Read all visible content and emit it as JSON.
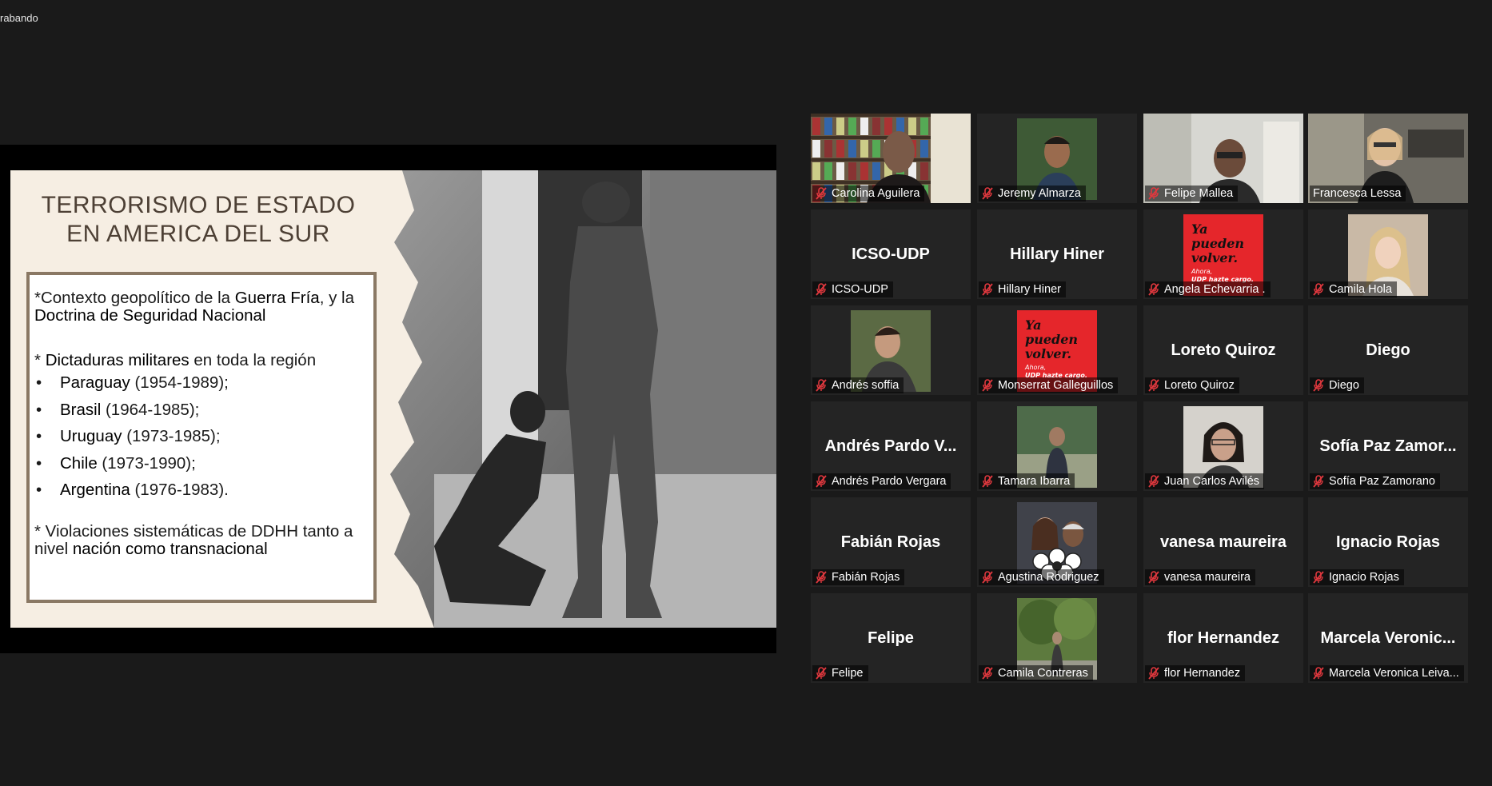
{
  "recording": {
    "label": "rabando"
  },
  "slide": {
    "title": "TERRORISMO DE ESTADO EN AMERICA DEL SUR",
    "intro_prefix": "*Contexto geopolítico de la ",
    "intro_bold1": "Guerra Fría",
    "intro_mid": ", y la ",
    "intro_bold2": "Doctrina de Seguridad Nacional",
    "dict_prefix": "* ",
    "dict_bold": "Dictaduras militares",
    "dict_suffix": " en toda la región",
    "countries": [
      {
        "name": "Paraguay",
        "years": " (1954-1989);"
      },
      {
        "name": "Brasil",
        "years": " (1964-1985);"
      },
      {
        "name": "Uruguay",
        "years": " (1973-1985);"
      },
      {
        "name": "Chile",
        "years": " (1973-1990);"
      },
      {
        "name": "Argentina",
        "years": " (1976-1983)."
      }
    ],
    "viol_prefix": "* Violaciones sistemáticas de DDHH tanto a nivel ",
    "viol_bold": "nación como transnacional"
  },
  "participants": [
    {
      "label": "Carolina Aguilera",
      "display": "",
      "video": "bookshelf"
    },
    {
      "label": "Jeremy Almarza",
      "display": "",
      "video": "portrait-green"
    },
    {
      "label": "Felipe Mallea",
      "display": "",
      "video": "office"
    },
    {
      "label": "Francesca Lessa",
      "display": "",
      "video": "office-blonde"
    },
    {
      "label": "ICSO-UDP",
      "display": "ICSO-UDP",
      "video": "none"
    },
    {
      "label": "Hillary Hiner",
      "display": "Hillary Hiner",
      "video": "none"
    },
    {
      "label": "Angela Echevarria .",
      "display": "",
      "video": "poster"
    },
    {
      "label": "Camila Hola",
      "display": "",
      "video": "portrait-blonde"
    },
    {
      "label": "Andrés soffia",
      "display": "",
      "video": "portrait-dark"
    },
    {
      "label": "Monserrat Galleguillos",
      "display": "",
      "video": "poster"
    },
    {
      "label": "Loreto Quiroz",
      "display": "Loreto Quiroz",
      "video": "none"
    },
    {
      "label": "Diego",
      "display": "Diego",
      "video": "none"
    },
    {
      "label": "Andrés Pardo Vergara",
      "display": "Andrés Pardo V...",
      "video": "none"
    },
    {
      "label": "Tamara Ibarra",
      "display": "",
      "video": "portrait-park"
    },
    {
      "label": "Juan Carlos Avilés",
      "display": "",
      "video": "portrait-glasses"
    },
    {
      "label": "Sofía Paz Zamorano",
      "display": "Sofía Paz Zamor...",
      "video": "none"
    },
    {
      "label": "Fabián Rojas",
      "display": "Fabián Rojas",
      "video": "none"
    },
    {
      "label": "Agustina Rodriguez",
      "display": "",
      "video": "couple"
    },
    {
      "label": "vanesa maureira",
      "display": "vanesa maureira",
      "video": "none"
    },
    {
      "label": "Ignacio Rojas",
      "display": "Ignacio Rojas",
      "video": "none"
    },
    {
      "label": "Felipe",
      "display": "Felipe",
      "video": "none"
    },
    {
      "label": "Camila Contreras",
      "display": "",
      "video": "portrait-tree"
    },
    {
      "label": "flor Hernandez",
      "display": "flor Hernandez",
      "video": "none"
    },
    {
      "label": "Marcela Veronica Leiva...",
      "display": "Marcela  Veronic...",
      "video": "none"
    }
  ],
  "poster": {
    "line1": "Ya",
    "line2": "pueden",
    "line3": "volver.",
    "line4": "Ahora,",
    "line5": "UDP hazte cargo."
  },
  "colors": {
    "active_speaker": "#c6e35d",
    "mic_muted": "#e0383e",
    "poster_red": "#e5262b"
  }
}
